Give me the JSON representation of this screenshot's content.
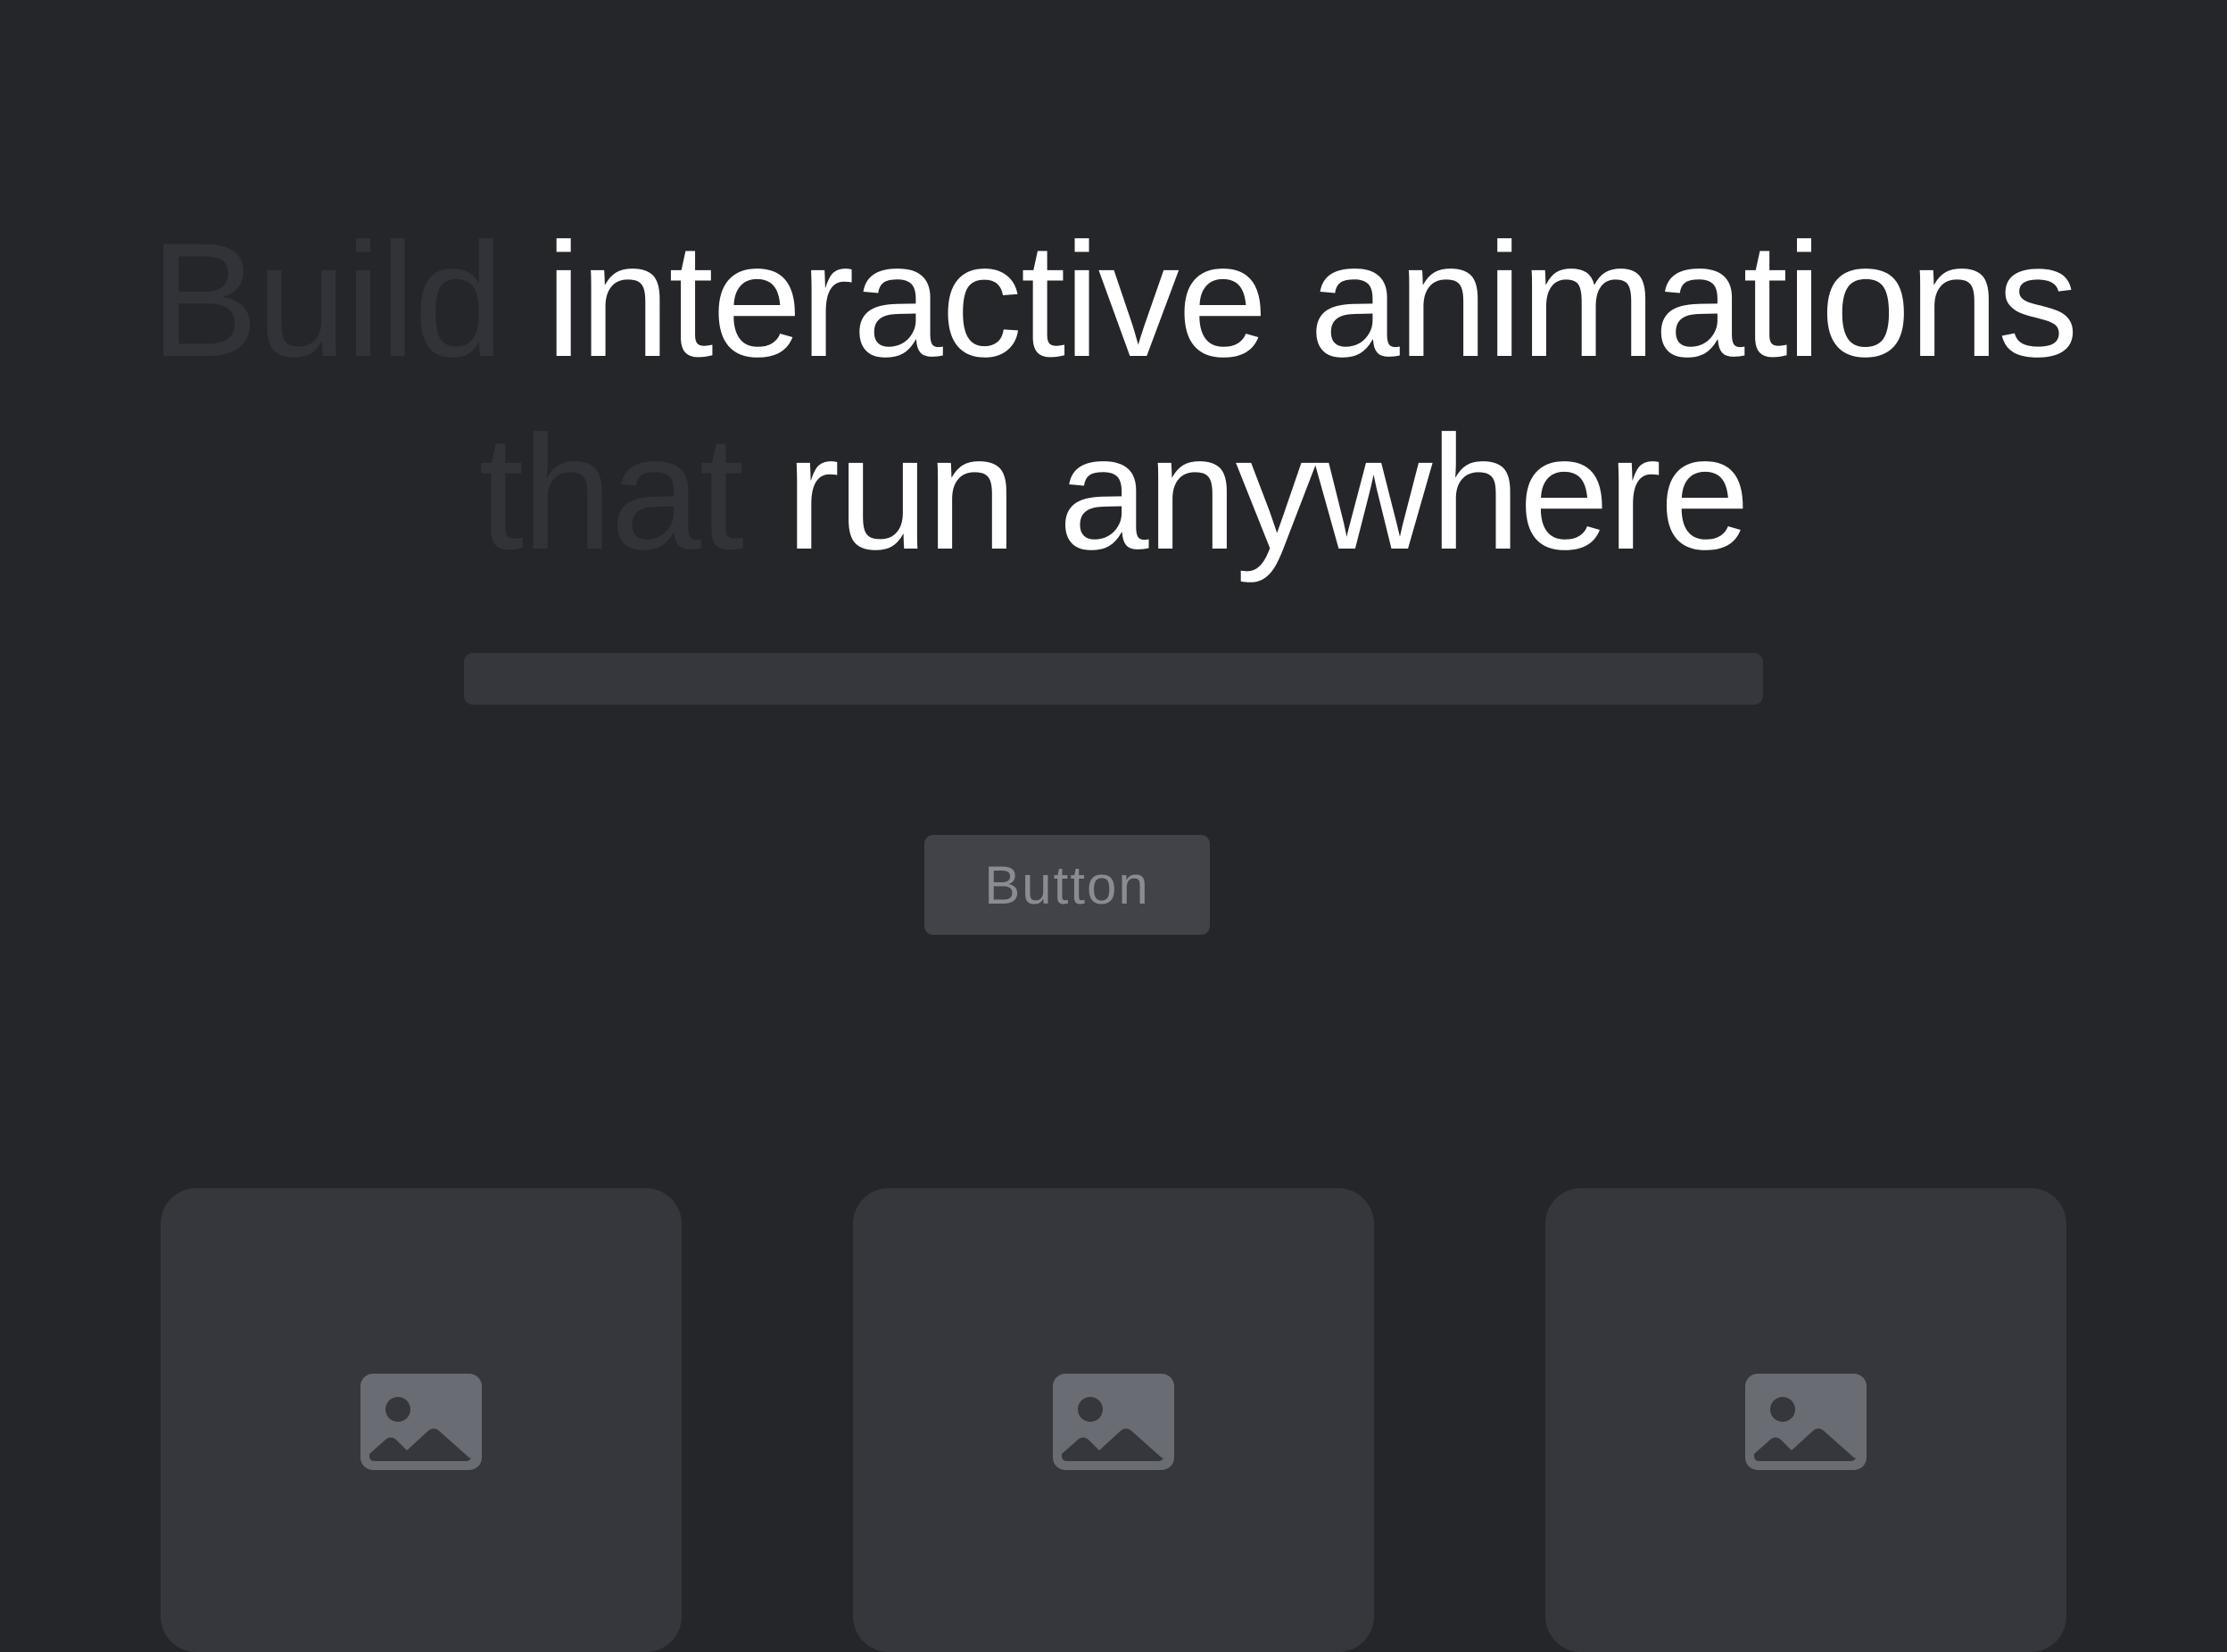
{
  "hero": {
    "line1_muted": "Build",
    "line1_main": "interactive animations",
    "line2_muted": "that",
    "line2_main": "run anywhere"
  },
  "cta": {
    "label": "Button"
  },
  "cards": [
    {
      "icon": "image-placeholder-icon"
    },
    {
      "icon": "image-placeholder-icon"
    },
    {
      "icon": "image-placeholder-icon"
    }
  ],
  "colors": {
    "background": "#25262a",
    "heading": "#ffffff",
    "heading_muted": "#323338",
    "surface": "#35373c",
    "button_bg": "#414349",
    "button_text": "#8a8c91",
    "icon": "#696c72"
  }
}
